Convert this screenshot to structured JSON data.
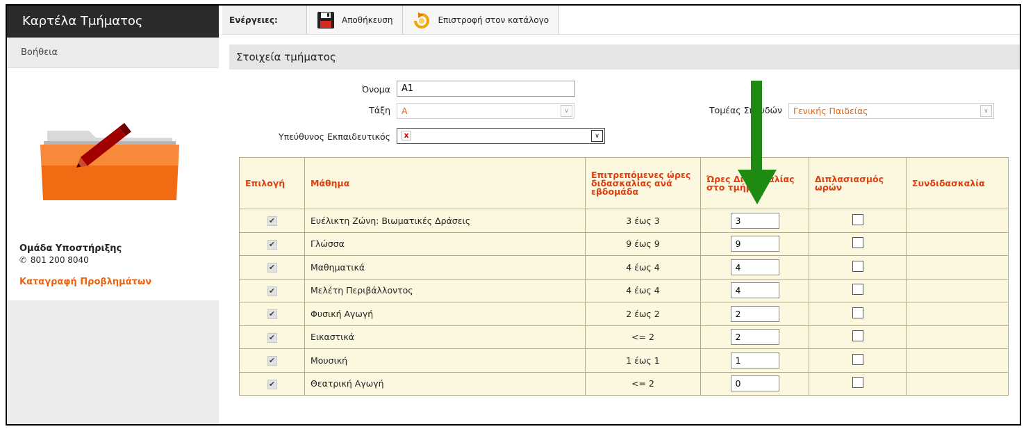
{
  "sidebar": {
    "title": "Καρτέλα Τμήματος",
    "help": "Βοήθεια",
    "folder_icon": "folder-edit-icon",
    "support_title": "Ομάδα Υποστήριξης",
    "support_phone": "801 200 8040",
    "phone_icon": "phone-icon",
    "report_link": "Καταγραφή Προβλημάτων"
  },
  "toolbar": {
    "label": "Ενέργειες:",
    "save_label": "Αποθήκευση",
    "save_icon": "floppy-disk-icon",
    "back_label": "Επιστροφή στον κατάλογο",
    "back_icon": "return-arrow-icon"
  },
  "section": {
    "title": "Στοιχεία τμήματος"
  },
  "form": {
    "name_label": "Όνομα",
    "name_value": "Α1",
    "class_label": "Τάξη",
    "class_value": "Α",
    "sector_label": "Τομέας Σπουδών",
    "sector_value": "Γενικής Παιδείας",
    "teacher_label": "Υπεύθυνος Εκπαιδευτικός",
    "teacher_value": ""
  },
  "colors": {
    "accent": "#e8640f",
    "header_text": "#e23d0e",
    "table_bg": "#fbf8df",
    "annotation_arrow": "#1f8a12"
  },
  "table": {
    "headers": {
      "select": "Επιλογή",
      "course": "Μάθημα",
      "allowed": "Επιτρεπόμενες ώρες διδασκαλίας ανά εβδομάδα",
      "hours": "Ώρες Διδασκαλίας στο τμήμα",
      "double": "Διπλασιασμός ωρών",
      "coteach": "Συνδιδασκαλία"
    },
    "rows": [
      {
        "selected": true,
        "course": "Ευέλικτη Ζώνη: Βιωματικές Δράσεις",
        "allowed": "3 έως 3",
        "hours": "3",
        "double": false
      },
      {
        "selected": true,
        "course": "Γλώσσα",
        "allowed": "9 έως 9",
        "hours": "9",
        "double": false
      },
      {
        "selected": true,
        "course": "Μαθηματικά",
        "allowed": "4 έως 4",
        "hours": "4",
        "double": false
      },
      {
        "selected": true,
        "course": "Μελέτη Περιβάλλοντος",
        "allowed": "4 έως 4",
        "hours": "4",
        "double": false
      },
      {
        "selected": true,
        "course": "Φυσική Αγωγή",
        "allowed": "2 έως 2",
        "hours": "2",
        "double": false
      },
      {
        "selected": true,
        "course": "Εικαστικά",
        "allowed": "<= 2",
        "hours": "2",
        "double": false
      },
      {
        "selected": true,
        "course": "Μουσική",
        "allowed": "1 έως 1",
        "hours": "1",
        "double": false
      },
      {
        "selected": true,
        "course": "Θεατρική Αγωγή",
        "allowed": "<= 2",
        "hours": "0",
        "double": false
      }
    ]
  }
}
